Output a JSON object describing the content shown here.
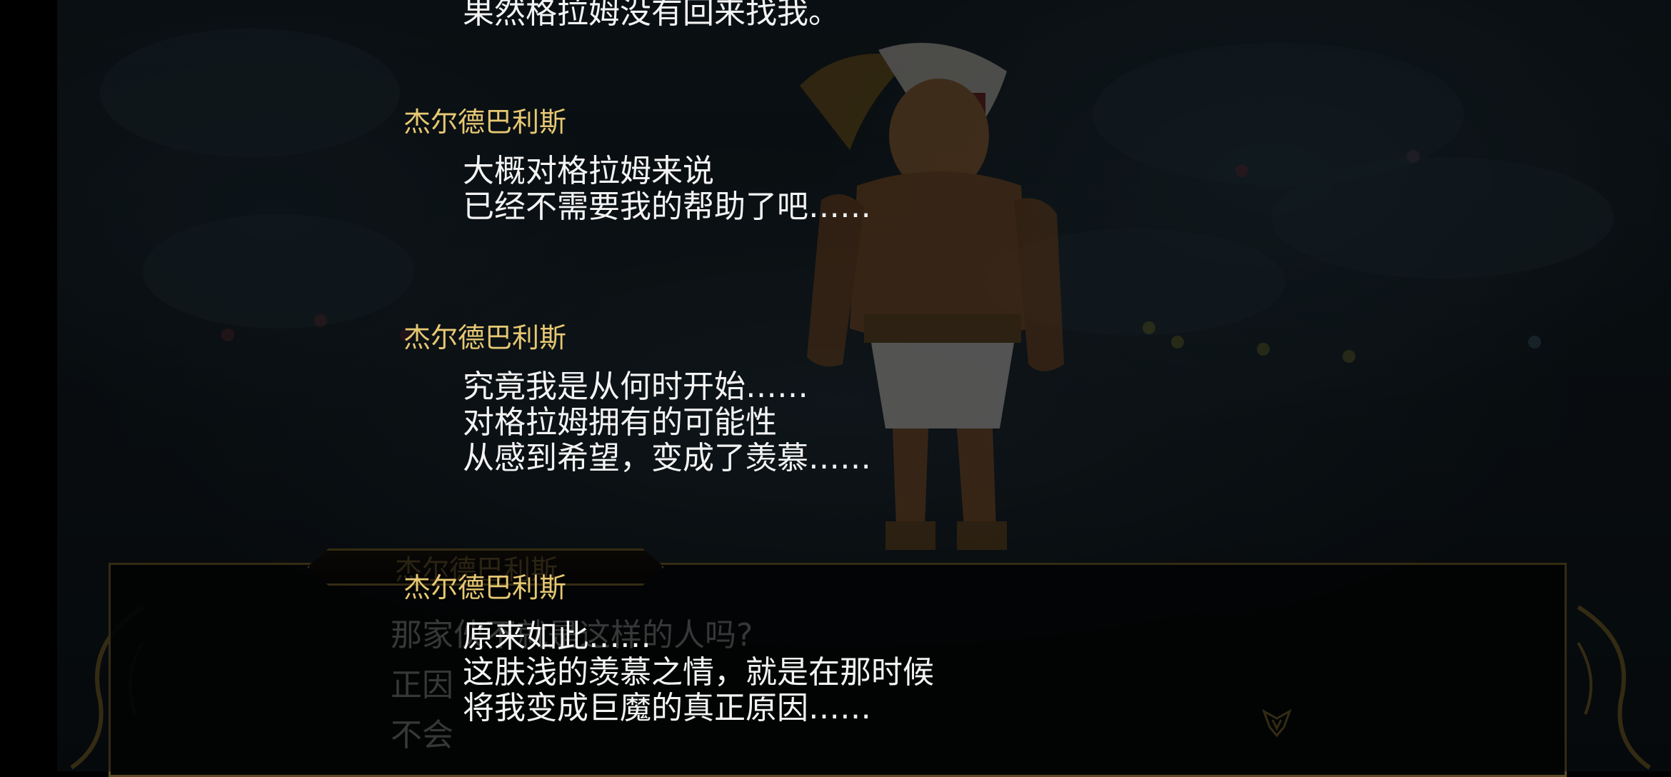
{
  "background_dialog": {
    "speaker": "杰尔德巴利斯",
    "lines": [
      "那家伙不就是这样的人吗?",
      "正因",
      "不会"
    ]
  },
  "backlog": {
    "partial_line": "果然格拉姆没有回来找我。",
    "entries": [
      {
        "speaker": "杰尔德巴利斯",
        "lines": [
          "大概对格拉姆来说",
          "已经不需要我的帮助了吧……"
        ]
      },
      {
        "speaker": "杰尔德巴利斯",
        "lines": [
          "究竟我是从何时开始……",
          "对格拉姆拥有的可能性",
          "从感到希望，变成了羡慕……"
        ]
      },
      {
        "speaker": "杰尔德巴利斯",
        "lines": [
          "原来如此……",
          "这肤浅的羡慕之情，就是在那时候",
          "将我变成巨魔的真正原因……"
        ]
      }
    ]
  },
  "colors": {
    "speaker": "#e7c873",
    "text": "#f3f3f3",
    "frame": "#5b4a22"
  },
  "icons": {
    "menu": "crest-icon"
  }
}
